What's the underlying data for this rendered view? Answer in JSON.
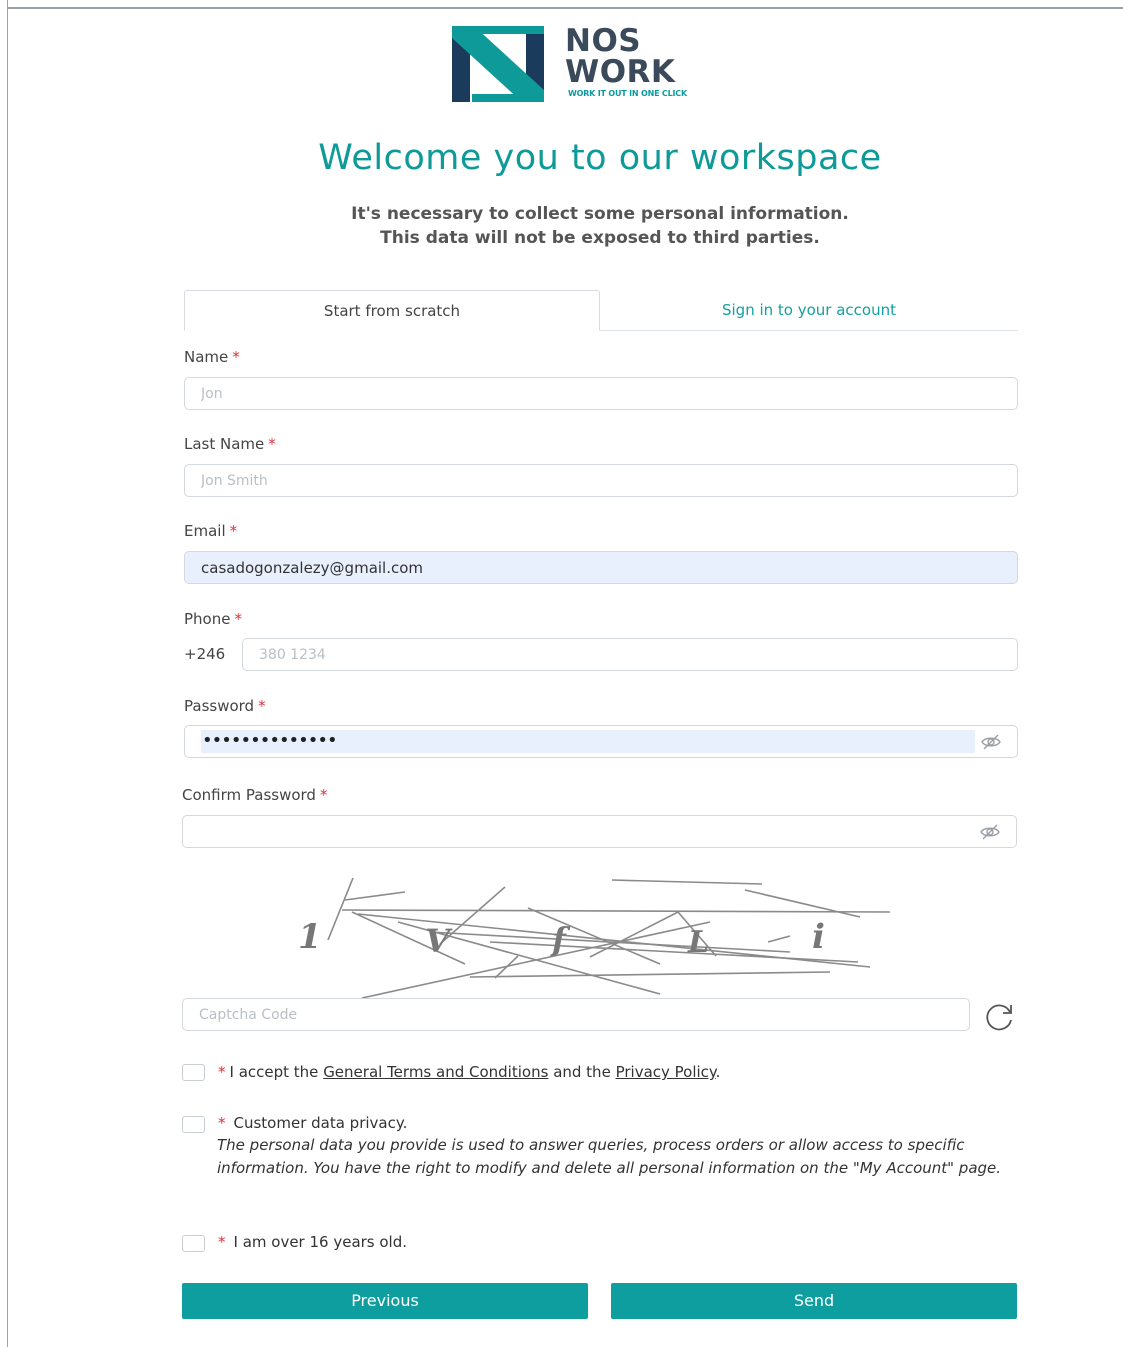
{
  "brand": {
    "line1": "NOS",
    "line2": "WORK",
    "tagline": "WORK IT OUT IN ONE CLICK",
    "colors": {
      "teal": "#0e9a98",
      "navy": "#1b3b5c",
      "dark": "#3a4a5a"
    }
  },
  "header": {
    "title": "Welcome you to our workspace",
    "subtitle_line1": "It's necessary to collect some personal information.",
    "subtitle_line2": "This data will not be exposed to third parties."
  },
  "tabs": [
    {
      "label": "Start from scratch",
      "active": true
    },
    {
      "label": "Sign in to your account",
      "active": false
    }
  ],
  "form": {
    "name": {
      "label": "Name",
      "required": "*",
      "placeholder": "Jon",
      "value": ""
    },
    "last_name": {
      "label": "Last Name",
      "required": "*",
      "placeholder": "Jon Smith",
      "value": ""
    },
    "email": {
      "label": "Email",
      "required": "*",
      "value": "casadogonzalezy@gmail.com"
    },
    "phone": {
      "label": "Phone",
      "required": "*",
      "prefix": "+246",
      "placeholder": "380 1234",
      "value": ""
    },
    "password": {
      "label": "Password",
      "required": "*",
      "masked_value": "••••••••••••••"
    },
    "confirm_password": {
      "label": "Confirm Password",
      "required": "*",
      "value": ""
    },
    "captcha": {
      "characters": [
        "1",
        "V",
        "f",
        "L",
        "i"
      ],
      "placeholder": "Captcha Code"
    }
  },
  "consents": {
    "terms": {
      "required": "*",
      "prefix": "I accept the",
      "link1": "General Terms and Conditions",
      "middle": "and the",
      "link2": "Privacy Policy",
      "suffix": "."
    },
    "privacy": {
      "required": "*",
      "label": "Customer data privacy.",
      "description": "The personal data you provide is used to answer queries, process orders or allow access to specific information. You have the right to modify and delete all personal information on the \"My Account\" page."
    },
    "age": {
      "required": "*",
      "label": "I am over 16 years old."
    }
  },
  "actions": {
    "previous": "Previous",
    "send": "Send"
  },
  "icons": {
    "eye_off": "eye-off-icon",
    "refresh": "refresh-icon"
  }
}
